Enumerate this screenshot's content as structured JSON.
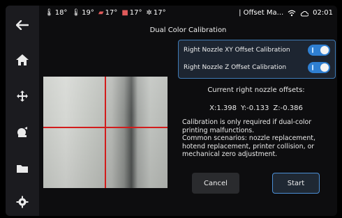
{
  "sidebar": {
    "items": [
      {
        "name": "back-arrow-icon",
        "glyph": "🠔"
      },
      {
        "name": "home-icon",
        "glyph": "⌂"
      },
      {
        "name": "move-icon",
        "glyph": "✥"
      },
      {
        "name": "calibration-nozzle-icon",
        "glyph": "⛏"
      },
      {
        "name": "folder-icon",
        "glyph": "▬"
      },
      {
        "name": "gear-icon",
        "glyph": "⚙"
      }
    ]
  },
  "status_bar": {
    "temps": [
      {
        "icon": "nozzle-left-icon",
        "value": "18°"
      },
      {
        "icon": "nozzle-right-icon",
        "value": "19°"
      },
      {
        "icon": "bed-icon",
        "value": "17°"
      },
      {
        "icon": "chamber-icon",
        "value": "17°"
      },
      {
        "icon": "fan-icon",
        "value": "17°"
      }
    ],
    "title": "| Offset Ma...",
    "time": "02:01"
  },
  "page": {
    "subtitle": "Dual Color Calibration"
  },
  "options": [
    {
      "label": "Right Nozzle XY Offset Calibration",
      "enabled": true
    },
    {
      "label": "Right Nozzle Z Offset Calibration",
      "enabled": true
    }
  ],
  "offsets": {
    "title": "Current right nozzle offsets:",
    "x": "X:1.398",
    "y": "Y:-0.133",
    "z": "Z:-0.386"
  },
  "note": {
    "line1": "Calibration is only required if dual-color printing malfunctions.",
    "line2": "Common scenarios: nozzle replacement, hotend replacement, printer collision, or mechanical zero adjustment."
  },
  "buttons": {
    "cancel": "Cancel",
    "start": "Start"
  },
  "colors": {
    "accent": "#2f7fd1",
    "crosshair": "#d21c1c"
  }
}
